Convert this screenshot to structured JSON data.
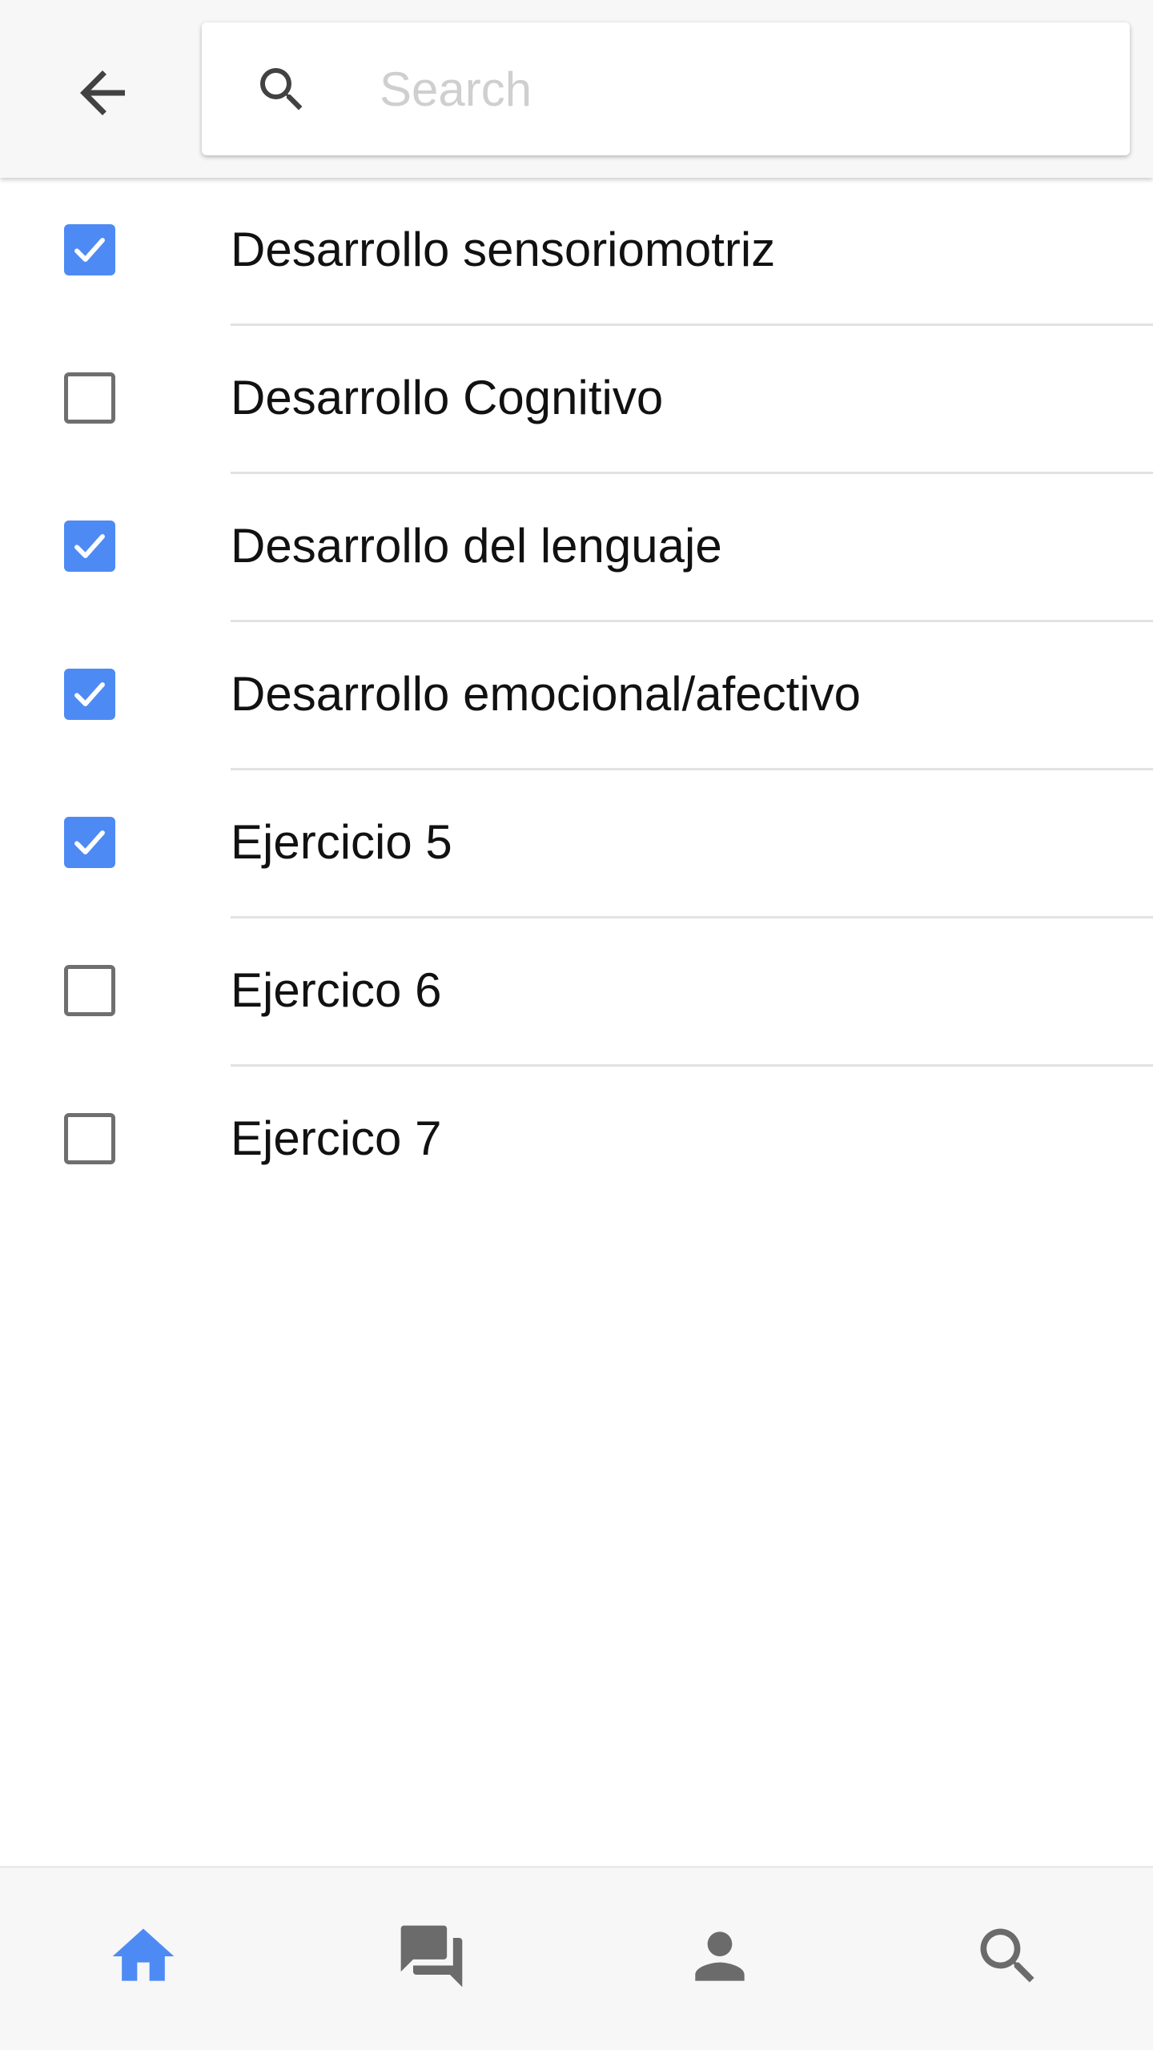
{
  "toolbar": {
    "back_icon": "arrow-back-icon",
    "search": {
      "icon": "search-icon",
      "placeholder": "Search",
      "value": ""
    }
  },
  "list": {
    "items": [
      {
        "label": "Desarrollo sensoriomotriz",
        "checked": true
      },
      {
        "label": "Desarrollo Cognitivo",
        "checked": false
      },
      {
        "label": "Desarrollo del lenguaje",
        "checked": true
      },
      {
        "label": "Desarrollo emocional/afectivo",
        "checked": true
      },
      {
        "label": "Ejercicio 5",
        "checked": true
      },
      {
        "label": "Ejercico 6",
        "checked": false
      },
      {
        "label": "Ejercico 7",
        "checked": false
      }
    ]
  },
  "bottom_nav": {
    "items": [
      {
        "icon": "home-icon",
        "active": true
      },
      {
        "icon": "chat-icon",
        "active": false
      },
      {
        "icon": "person-icon",
        "active": false
      },
      {
        "icon": "search-icon",
        "active": false
      }
    ]
  },
  "colors": {
    "accent": "#4e8af4",
    "icon_inactive": "#6b6b6b",
    "checkbox_unchecked_border": "#6f6f6f",
    "divider": "#e2e2e2",
    "bar_background": "#f7f7f7"
  }
}
